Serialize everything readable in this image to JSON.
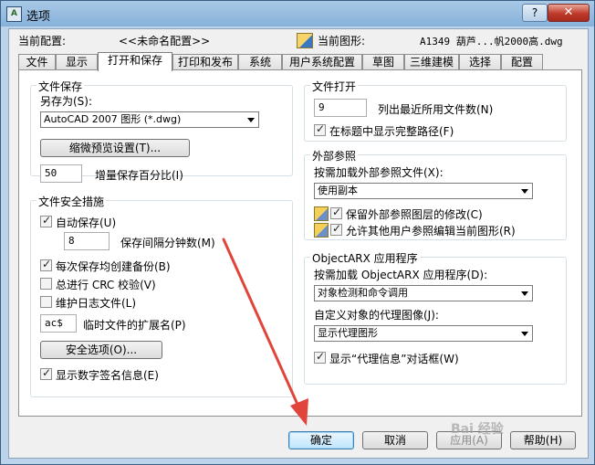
{
  "window": {
    "title": "选项",
    "help": "?",
    "close": "✕"
  },
  "header": {
    "cur_profile_label": "当前配置:",
    "cur_profile_value": "<<未命名配置>>",
    "cur_drawing_label": "当前图形:",
    "cur_drawing_value": "A1349 葫芦...帆2000高.dwg"
  },
  "tabs": [
    "文件",
    "显示",
    "打开和保存",
    "打印和发布",
    "系统",
    "用户系统配置",
    "草图",
    "三维建模",
    "选择",
    "配置"
  ],
  "active_tab": "打开和保存",
  "file_save": {
    "legend": "文件保存",
    "save_as_label": "另存为(S):",
    "save_as_value": "AutoCAD 2007 图形 (*.dwg)",
    "thumb_button": "缩微预览设置(T)...",
    "incr_value": "50",
    "incr_label": "增量保存百分比(I)"
  },
  "file_safety": {
    "legend": "文件安全措施",
    "autosave_label": "自动保存(U)",
    "autosave_checked": true,
    "interval_value": "8",
    "interval_label": "保存间隔分钟数(M)",
    "backup_label": "每次保存均创建备份(B)",
    "backup_checked": true,
    "crc_label": "总进行 CRC 校验(V)",
    "crc_checked": false,
    "log_label": "维护日志文件(L)",
    "log_checked": false,
    "ext_value": "ac$",
    "ext_label": "临时文件的扩展名(P)",
    "security_button": "安全选项(O)...",
    "digsig_label": "显示数字签名信息(E)",
    "digsig_checked": true
  },
  "file_open": {
    "legend": "文件打开",
    "recent_value": "9",
    "recent_label": "列出最近所用文件数(N)",
    "fullpath_label": "在标题中显示完整路径(F)",
    "fullpath_checked": true
  },
  "xref": {
    "legend": "外部参照",
    "demand_label": "按需加载外部参照文件(X):",
    "demand_value": "使用副本",
    "retain_label": "保留外部参照图层的修改(C)",
    "retain_checked": true,
    "allow_label": "允许其他用户参照编辑当前图形(R)",
    "allow_checked": true
  },
  "arx": {
    "legend": "ObjectARX 应用程序",
    "demand_label": "按需加载 ObjectARX 应用程序(D):",
    "demand_value": "对象检测和命令调用",
    "proxy_label": "自定义对象的代理图像(J):",
    "proxy_value": "显示代理图形",
    "proxyinfo_label": "显示“代理信息”对话框(W)",
    "proxyinfo_checked": true
  },
  "buttons": {
    "ok": "确定",
    "cancel": "取消",
    "apply": "应用(A)",
    "help": "帮助(H)"
  },
  "watermark": "Bai 经验",
  "colors": {
    "annotation_arrow": "#e0443a",
    "title_bar": "#86b1d9",
    "close_button": "#c0392b"
  }
}
